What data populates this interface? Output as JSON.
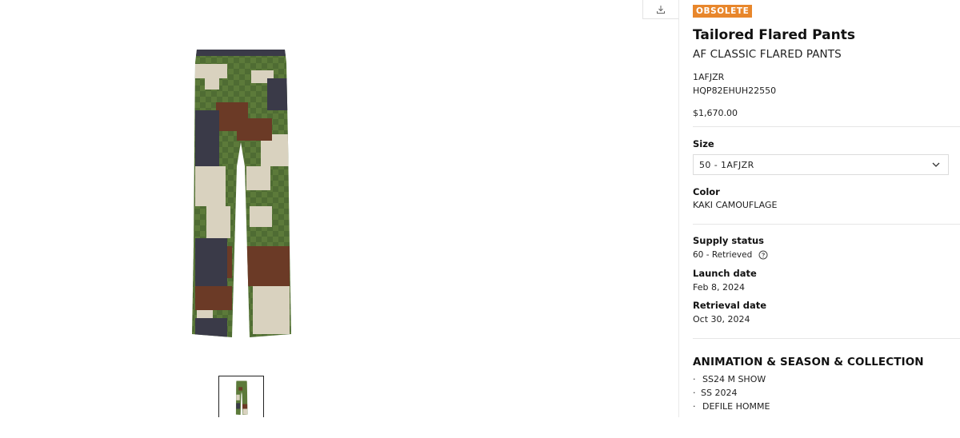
{
  "toolbar": {
    "download_icon": "download-icon"
  },
  "gallery": {
    "main_image_alt": "camouflage flared pants",
    "thumbnails": [
      {
        "alt": "camouflage flared pants thumbnail",
        "selected": true
      }
    ],
    "colors": {
      "khaki_green": "#5c7a3a",
      "brown": "#6b3a26",
      "beige": "#d9d2bf",
      "navy": "#3a3a48"
    }
  },
  "product": {
    "badge": "OBSOLETE",
    "badge_color": "#e8862b",
    "title": "Tailored Flared Pants",
    "subtitle": "AF CLASSIC FLARED PANTS",
    "ref_code": "1AFJZR",
    "sku": "HQP82EHUH22550",
    "price": "$1,670.00",
    "size_label": "Size",
    "size_selected": "50 - 1AFJZR",
    "color_label": "Color",
    "color_value": "KAKI CAMOUFLAGE",
    "supply_status_label": "Supply status",
    "supply_status_value": "60 - Retrieved",
    "launch_date_label": "Launch date",
    "launch_date_value": "Feb 8, 2024",
    "retrieval_date_label": "Retrieval date",
    "retrieval_date_value": "Oct 30, 2024"
  },
  "collection": {
    "title": "ANIMATION & SEASON & COLLECTION",
    "items": [
      {
        "bullet": "·",
        "label": "SS24 M SHOW"
      },
      {
        "bullet": "·",
        "label": "SS 2024"
      },
      {
        "bullet": "·",
        "label": "DEFILE HOMME"
      }
    ]
  }
}
